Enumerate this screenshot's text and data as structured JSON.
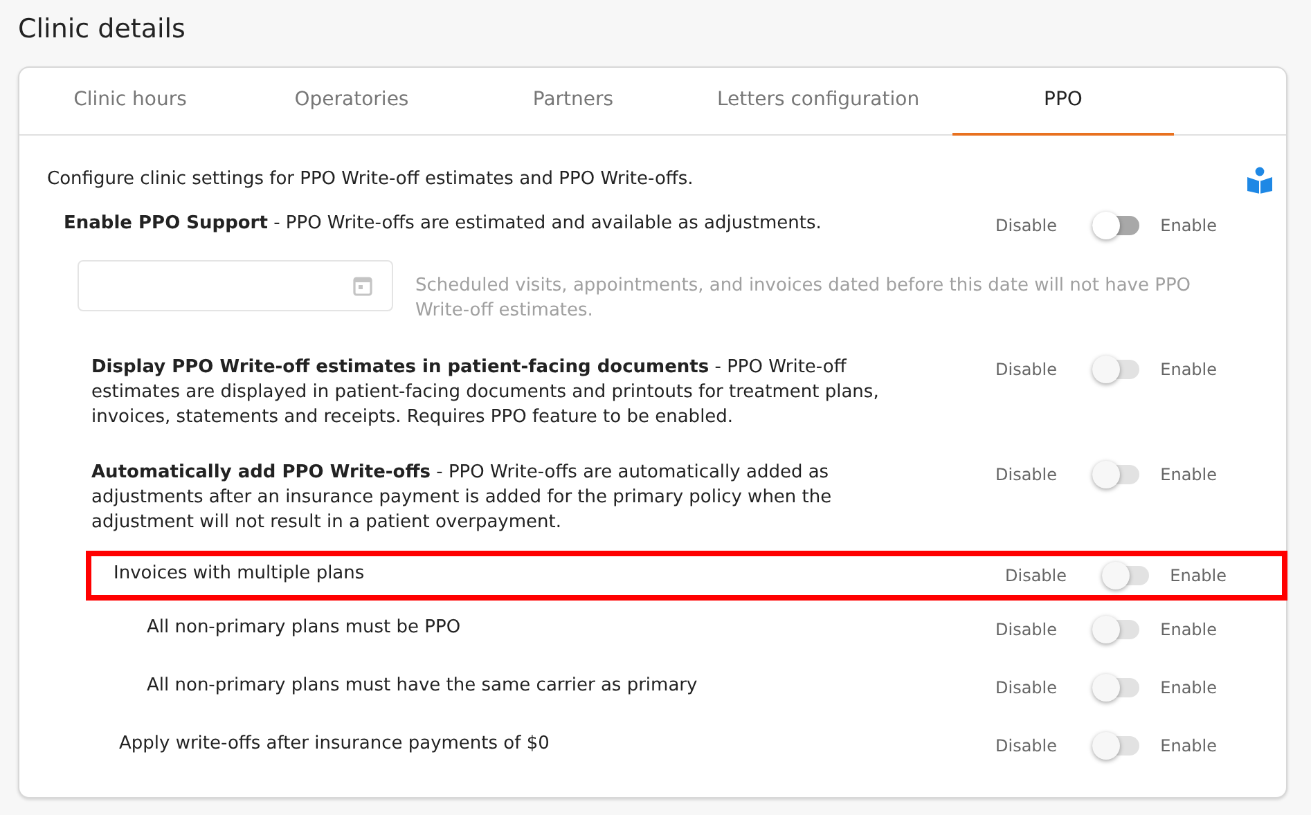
{
  "page_title": "Clinic details",
  "tabs": [
    {
      "label": "Clinic hours",
      "selected": false
    },
    {
      "label": "Operatories",
      "selected": false
    },
    {
      "label": "Partners",
      "selected": false
    },
    {
      "label": "Letters configuration",
      "selected": false
    },
    {
      "label": "PPO",
      "selected": true
    }
  ],
  "intro": "Configure clinic settings for PPO Write-off estimates and PPO Write-offs.",
  "settings": [
    {
      "text": "**Enable PPO Support** - PPO Write-offs are estimated and available as adjustments.",
      "off_label": "Disable",
      "on_label": "Enable",
      "on": false,
      "disabled": false,
      "highlighted": false,
      "date_filter": {
        "hint": "Scheduled visits, appointments, and invoices dated before this date will not have PPO Write-off estimates.",
        "disabled": true
      },
      "children": [
        {
          "text": "**Display PPO Write-off estimates in patient-facing documents** - PPO Write-off estimates are displayed in patient-facing documents and printouts for treatment plans, invoices, statements and receipts. Requires PPO feature to be enabled.",
          "off_label": "Disable",
          "on_label": "Enable",
          "on": false,
          "disabled": true,
          "highlighted": false
        },
        {
          "text": "**Automatically add PPO Write-offs** - PPO Write-offs are automatically added as adjustments after an insurance payment is added for the primary policy when the adjustment will not result in a patient overpayment.",
          "off_label": "Disable",
          "on_label": "Enable",
          "on": false,
          "disabled": true,
          "highlighted": false,
          "children": [
            {
              "text": "Invoices with multiple plans",
              "off_label": "Disable",
              "on_label": "Enable",
              "on": false,
              "disabled": true,
              "highlighted": true,
              "children": [
                {
                  "text": "All non-primary plans must be PPO",
                  "off_label": "Disable",
                  "on_label": "Enable",
                  "on": false,
                  "disabled": true,
                  "highlighted": false
                },
                {
                  "text": "All non-primary plans must have the same carrier as primary",
                  "off_label": "Disable",
                  "on_label": "Enable",
                  "on": false,
                  "disabled": true,
                  "highlighted": false
                }
              ]
            },
            {
              "text": "Apply write-offs after insurance payments of $0",
              "off_label": "Disable",
              "on_label": "Enable",
              "on": false,
              "disabled": true,
              "highlighted": false
            }
          ]
        }
      ]
    }
  ]
}
